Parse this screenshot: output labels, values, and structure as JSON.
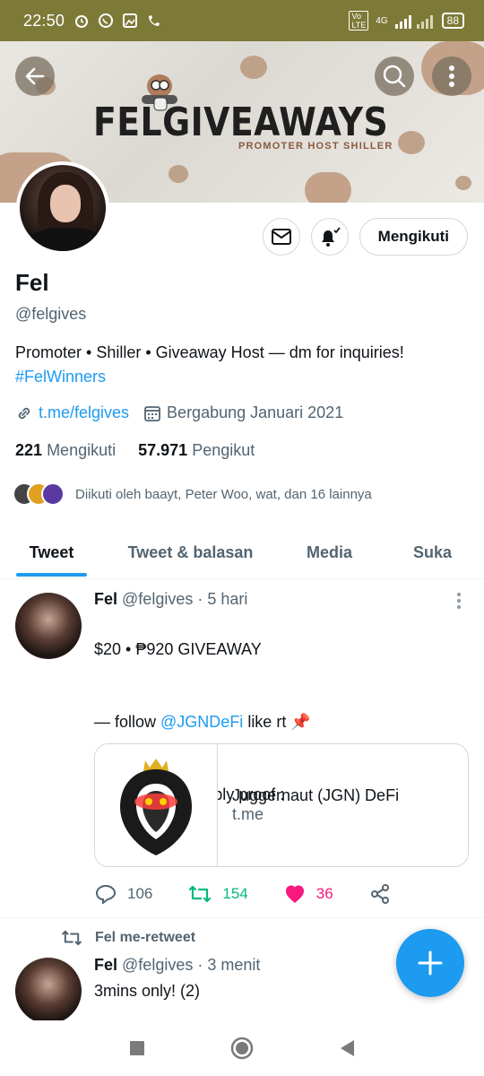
{
  "status_bar": {
    "time": "22:50",
    "network": "4G",
    "battery": "88"
  },
  "banner": {
    "title": "FELGIVEAWAYS",
    "subtitle": "PROMOTER  HOST  SHILLER"
  },
  "profile": {
    "name": "Fel",
    "handle": "@felgives",
    "bio": "Promoter • Shiller • Giveaway Host — dm for inquiries!",
    "bio_hashtag": "#FelWinners",
    "link": "t.me/felgives",
    "joined": "Bergabung Januari 2021",
    "following_count": "221",
    "following_label": "Mengikuti",
    "followers_count": "57.971",
    "followers_label": "Pengikut",
    "followed_by": "Diikuti oleh baayt, Peter Woo, wat, dan 16 lainnya",
    "follow_button": "Mengikuti"
  },
  "tabs": [
    {
      "label": "Tweet",
      "active": true
    },
    {
      "label": "Tweet & balasan",
      "active": false
    },
    {
      "label": "Media",
      "active": false
    },
    {
      "label": "Suka",
      "active": false
    }
  ],
  "tweet1": {
    "name": "Fel",
    "handle": "@felgives",
    "time": "· 5 hari",
    "line1": "$20 • ₱920 GIVEAWAY",
    "line2_prefix": "— follow ",
    "line2_mention": "@JGNDeFi",
    "line2_suffix": " like rt 📌",
    "line3": "— rt  join TG + reply proof :",
    "card_title": "Juggernaut (JGN) DeFi",
    "card_domain": "t.me",
    "replies": "106",
    "retweets": "154",
    "likes": "36"
  },
  "tweet2": {
    "retweet_label": "Fel me-retweet",
    "name": "Fel",
    "handle": "@felgives",
    "time": "· 3 menit",
    "text": "3mins only! (2)"
  },
  "colors": {
    "accent": "#1d9bf0",
    "retweet": "#00ba7c",
    "like": "#f91880",
    "status_bar": "#7d7a38"
  }
}
